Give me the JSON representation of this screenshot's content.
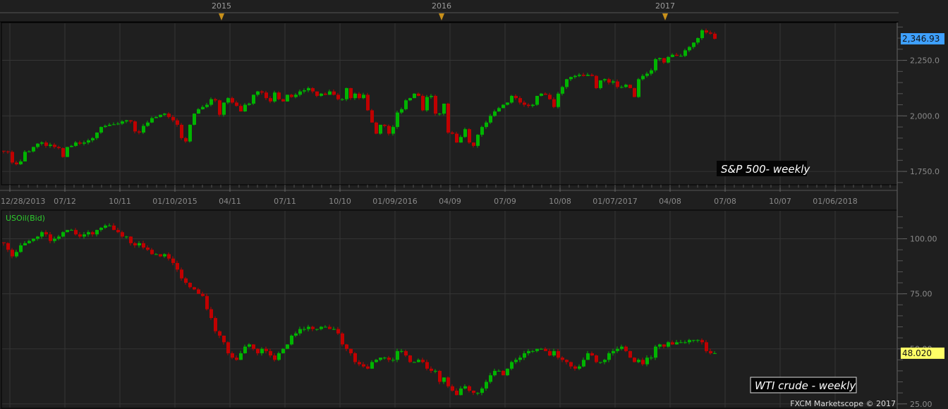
{
  "colors": {
    "up": "#00b400",
    "down": "#c00000",
    "grid": "#353535",
    "bg": "#1f1f1f",
    "sp_last_bg": "#3ea0ff",
    "oil_last_bg": "#ffff66",
    "marker": "#c8901a"
  },
  "year_markers": [
    "2015",
    "2016",
    "2017"
  ],
  "date_labels": [
    "12/28/2013",
    "07/12",
    "10/11",
    "01/10/2015",
    "04/11",
    "07/11",
    "10/10",
    "01/09/2016",
    "04/09",
    "07/09",
    "10/08",
    "01/07/2017",
    "04/08",
    "07/08",
    "10/07",
    "01/06/2018"
  ],
  "footer": "FXCM Marketscope © 2017",
  "chart_data": [
    {
      "type": "candlestick",
      "title": "S&P 500- weekly",
      "ylabel": "",
      "yticks": [
        "2,250.0",
        "2,000.0",
        "1,750.0"
      ],
      "ytick_values": [
        2250,
        2000,
        1750
      ],
      "ylim": [
        1690,
        2420
      ],
      "last_value_label": "2,346.93",
      "last_value": 2346.93,
      "weekly_closes": [
        1840,
        1838,
        1790,
        1782,
        1795,
        1838,
        1840,
        1860,
        1875,
        1880,
        1865,
        1870,
        1860,
        1855,
        1815,
        1860,
        1865,
        1880,
        1875,
        1880,
        1890,
        1900,
        1925,
        1950,
        1955,
        1960,
        1962,
        1965,
        1975,
        1980,
        1975,
        1930,
        1925,
        1955,
        1970,
        1990,
        1995,
        2005,
        2010,
        1995,
        1980,
        1960,
        1900,
        1885,
        1960,
        2010,
        2030,
        2040,
        2050,
        2075,
        2070,
        2005,
        2060,
        2080,
        2060,
        2045,
        2020,
        2050,
        2055,
        2095,
        2110,
        2105,
        2080,
        2065,
        2105,
        2075,
        2065,
        2095,
        2085,
        2095,
        2110,
        2115,
        2125,
        2110,
        2090,
        2100,
        2095,
        2110,
        2095,
        2075,
        2075,
        2125,
        2080,
        2100,
        2080,
        2095,
        2025,
        1970,
        1920,
        1960,
        1955,
        1920,
        1950,
        2015,
        2030,
        2070,
        2080,
        2100,
        2090,
        2025,
        2085,
        2090,
        2010,
        2010,
        2055,
        1925,
        1920,
        1880,
        1905,
        1940,
        1880,
        1865,
        1915,
        1950,
        1970,
        2000,
        2020,
        2035,
        2050,
        2060,
        2090,
        2080,
        2060,
        2050,
        2045,
        2050,
        2090,
        2100,
        2095,
        2075,
        2040,
        2100,
        2130,
        2165,
        2175,
        2180,
        2185,
        2180,
        2185,
        2180,
        2125,
        2160,
        2165,
        2150,
        2155,
        2130,
        2130,
        2140,
        2125,
        2085,
        2165,
        2180,
        2190,
        2205,
        2255,
        2260,
        2240,
        2265,
        2275,
        2270,
        2270,
        2295,
        2310,
        2330,
        2350,
        2385,
        2375,
        2370,
        2346.93
      ]
    },
    {
      "type": "candlestick",
      "title": "WTI crude - weekly",
      "series_label": "USOil(Bid)",
      "yticks": [
        "100.00",
        "75.00",
        "50.00",
        "25.00"
      ],
      "ytick_values": [
        100,
        75,
        50,
        25
      ],
      "ylim": [
        23,
        113
      ],
      "last_value_label": "48.020",
      "last_value": 48.02,
      "weekly_closes": [
        98,
        95,
        92,
        94,
        97,
        98,
        99,
        100,
        101,
        103,
        102,
        99,
        100,
        101,
        103,
        104,
        104,
        102,
        101,
        102,
        103,
        102,
        104,
        105,
        106,
        106,
        104,
        103,
        101,
        101,
        98,
        97,
        98,
        96,
        95,
        93,
        93,
        92,
        93,
        91,
        89,
        86,
        82,
        80,
        78,
        77,
        75,
        74,
        68,
        64,
        58,
        56,
        53,
        48,
        46,
        45,
        48,
        51,
        52,
        50,
        48,
        50,
        49,
        47,
        45,
        48,
        50,
        52,
        56,
        57,
        59,
        59,
        60,
        59,
        59,
        60,
        60,
        59,
        59,
        57,
        52,
        50,
        48,
        44,
        43,
        42,
        41,
        44,
        45,
        46,
        46,
        45,
        45,
        49,
        49,
        47,
        44,
        44,
        45,
        44,
        41,
        40,
        40,
        35,
        37,
        33,
        31,
        29,
        32,
        33,
        31,
        30,
        30,
        32,
        35,
        38,
        40,
        40,
        38,
        41,
        44,
        45,
        46,
        48,
        49,
        49,
        50,
        50,
        49,
        47,
        49,
        46,
        45,
        44,
        42,
        41,
        42,
        45,
        48,
        47,
        44,
        44,
        45,
        48,
        49,
        50,
        51,
        49,
        46,
        44,
        45,
        43,
        46,
        46,
        51,
        52,
        51,
        53,
        52,
        53,
        53,
        53,
        54,
        54,
        54,
        53,
        49,
        48,
        48.02
      ]
    }
  ]
}
